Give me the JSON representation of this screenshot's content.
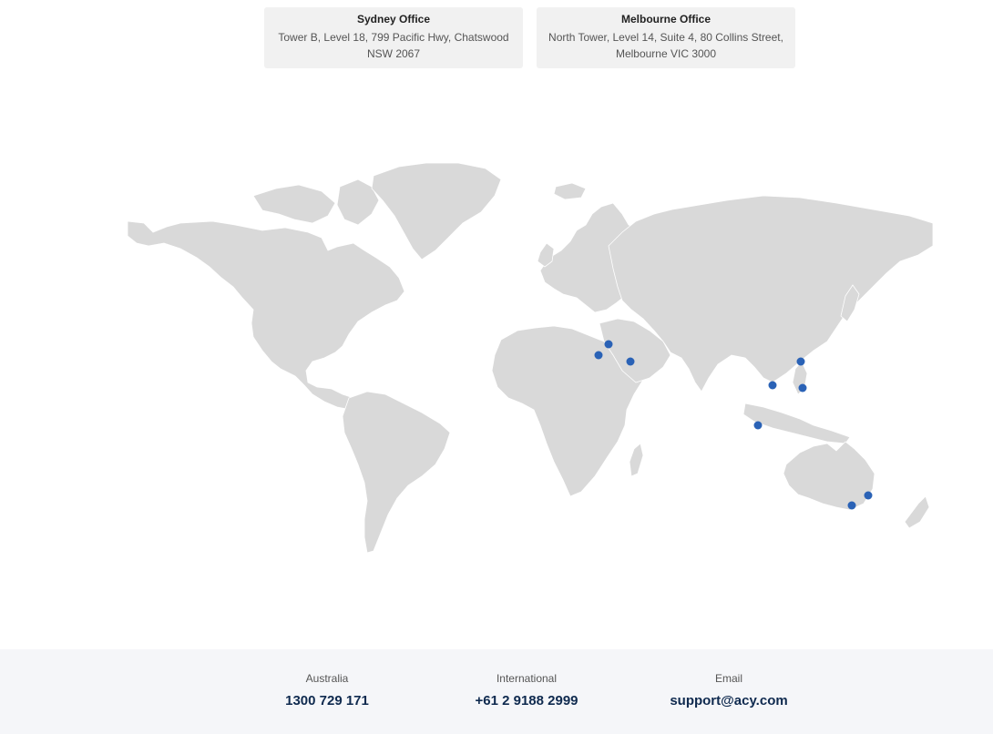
{
  "offices": [
    {
      "title": "Sydney Office",
      "address": "Tower B, Level 18, 799 Pacific Hwy, Chatswood NSW 2067"
    },
    {
      "title": "Melbourne Office",
      "address": "North Tower, Level 14, Suite 4, 80 Collins Street, Melbourne VIC 3000"
    }
  ],
  "map": {
    "land_color": "#d9d9d9",
    "marker_color": "#2a62b6",
    "markers": [
      {
        "name": "marker-egypt"
      },
      {
        "name": "marker-jordan"
      },
      {
        "name": "marker-saudi-arabia"
      },
      {
        "name": "marker-taiwan"
      },
      {
        "name": "marker-vietnam"
      },
      {
        "name": "marker-philippines"
      },
      {
        "name": "marker-indonesia"
      },
      {
        "name": "marker-sydney"
      },
      {
        "name": "marker-melbourne"
      }
    ]
  },
  "footer": {
    "background": "#f5f6f9",
    "australia": {
      "label": "Australia",
      "value": "1300 729 171"
    },
    "international": {
      "label": "International",
      "value": "+61 2 9188 2999"
    },
    "email": {
      "label": "Email",
      "value": "support@acy.com"
    }
  }
}
